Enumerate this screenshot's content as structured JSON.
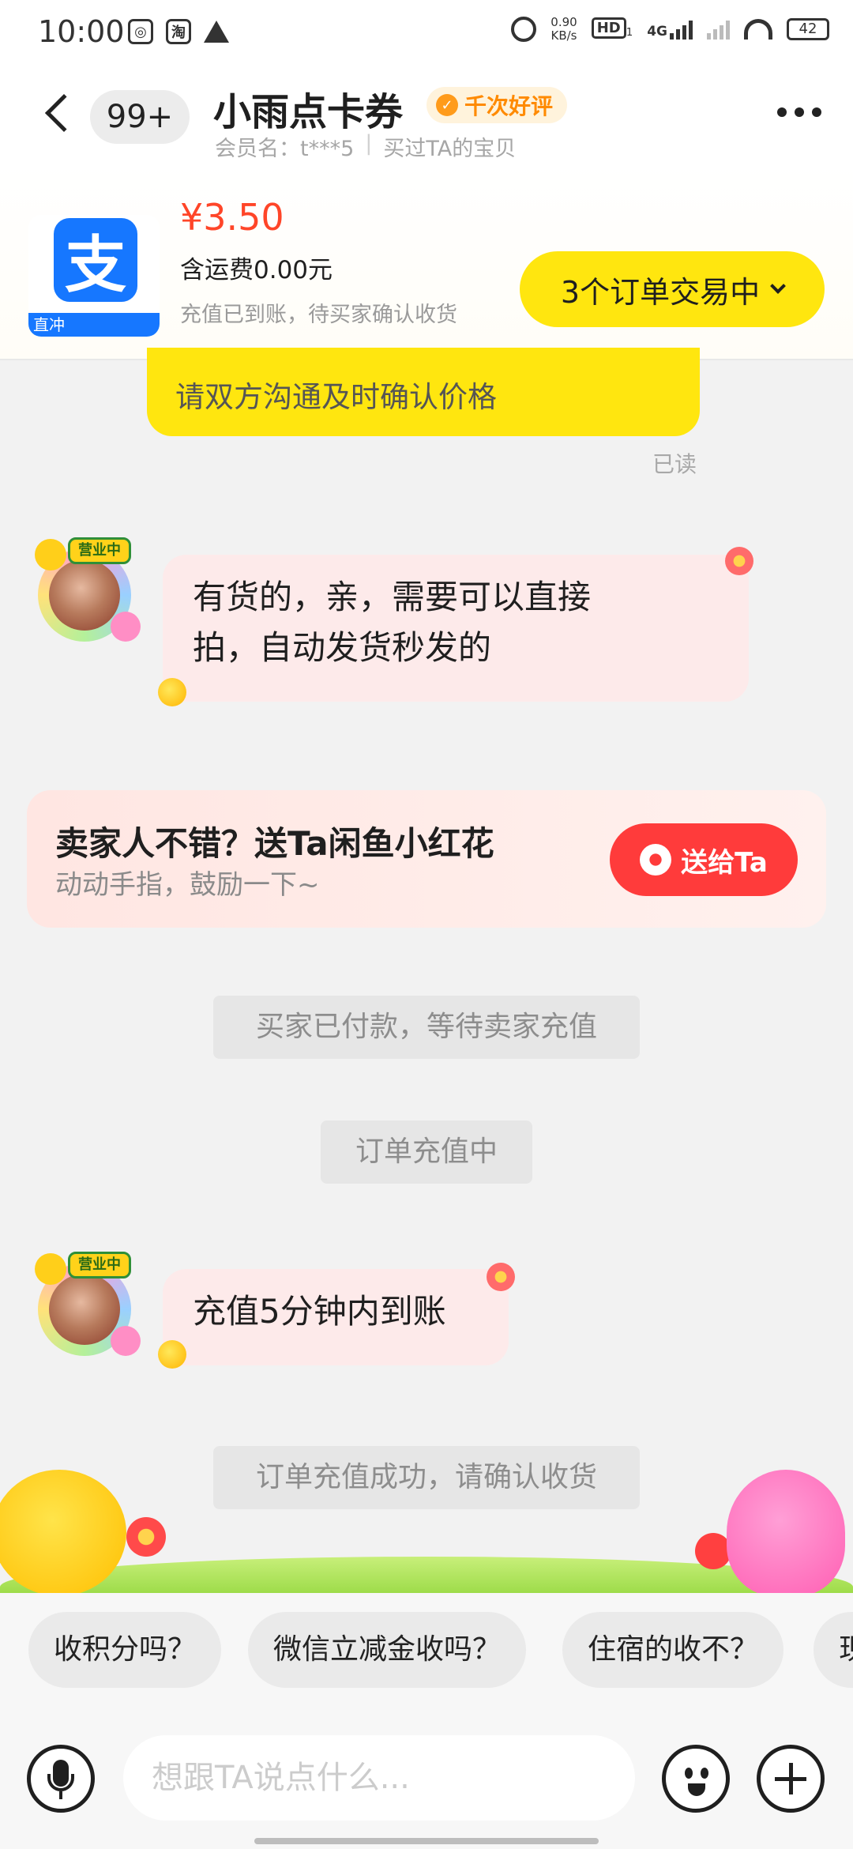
{
  "status_bar": {
    "time": "10:00",
    "network_speed": "0.90",
    "network_unit": "KB/s",
    "hd": "HD",
    "hd_sub": "1",
    "net_type": "4G",
    "battery": "42",
    "left_icon_2": "淘"
  },
  "header": {
    "unread_count": "99+",
    "title": "小雨点卡券",
    "badge": "千次好评",
    "member": "会员名：t***5",
    "purchased": "买过TA的宝贝"
  },
  "order": {
    "price": "¥3.50",
    "shipping": "含运费0.00元",
    "status": "充值已到账，待买家确认收货",
    "product_logo": "支",
    "product_band": "直冲",
    "trading_button": "3个订单交易中"
  },
  "chat": {
    "self_message": "请双方沟通及时确认价格",
    "read_status": "已读",
    "avatar_tag": "营业中",
    "msg1_line1": "有货的，亲，需要可以直接",
    "msg1_line2": "拍，自动发货秒发的",
    "gift_title": "卖家人不错？送Ta闲鱼小红花",
    "gift_subtitle": "动动手指，鼓励一下~",
    "gift_button": "送给Ta",
    "system_paid": "买家已付款，等待卖家充值",
    "system_recharging": "订单充值中",
    "msg2": "充值5分钟内到账",
    "system_success": "订单充值成功，请确认收货"
  },
  "quick_replies": [
    "收积分吗？",
    "微信立减金收吗？",
    "住宿的收不？",
    "现"
  ],
  "input": {
    "placeholder": "想跟TA说点什么..."
  },
  "colors": {
    "accent_yellow": "#ffe60f",
    "price_red": "#ff4528",
    "gift_red": "#ff3b3b",
    "bubble_pink": "#fdeaea",
    "alipay_blue": "#1677ff"
  },
  "icons": [
    "back-icon",
    "more-icon",
    "thumb-icon",
    "chevron-down-icon",
    "flower-icon",
    "mic-icon",
    "emoji-icon",
    "plus-icon"
  ]
}
